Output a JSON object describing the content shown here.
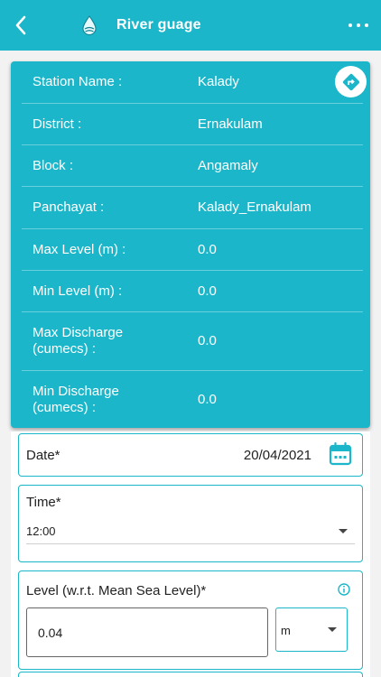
{
  "header": {
    "title": "River guage",
    "back_icon": "back-chevron-icon",
    "logo_icon": "water-drop-icon",
    "menu_icon": "more-horizontal-icon"
  },
  "station": {
    "rows": [
      {
        "label": "Station Name :",
        "value": "Kalady"
      },
      {
        "label": "District :",
        "value": "Ernakulam"
      },
      {
        "label": "Block :",
        "value": "Angamaly"
      },
      {
        "label": "Panchayat :",
        "value": "Kalady_Ernakulam"
      },
      {
        "label": "Max Level (m) :",
        "value": "0.0"
      },
      {
        "label": "Min Level (m) :",
        "value": "0.0"
      },
      {
        "label": "Max Discharge (cumecs) :",
        "value": "0.0"
      },
      {
        "label": "Min Discharge (cumecs) :",
        "value": "0.0"
      }
    ],
    "directions_icon": "directions-icon"
  },
  "form": {
    "date": {
      "label": "Date*",
      "value": "20/04/2021",
      "icon": "calendar-icon"
    },
    "time": {
      "label": "Time*",
      "value": "12:00"
    },
    "level": {
      "label": "Level (w.r.t. Mean Sea Level)*",
      "value": "0.04",
      "unit": "m",
      "info_icon": "info-icon"
    }
  },
  "colors": {
    "primary": "#1bb6c9",
    "background": "#f2f2f2",
    "text": "#222222"
  }
}
